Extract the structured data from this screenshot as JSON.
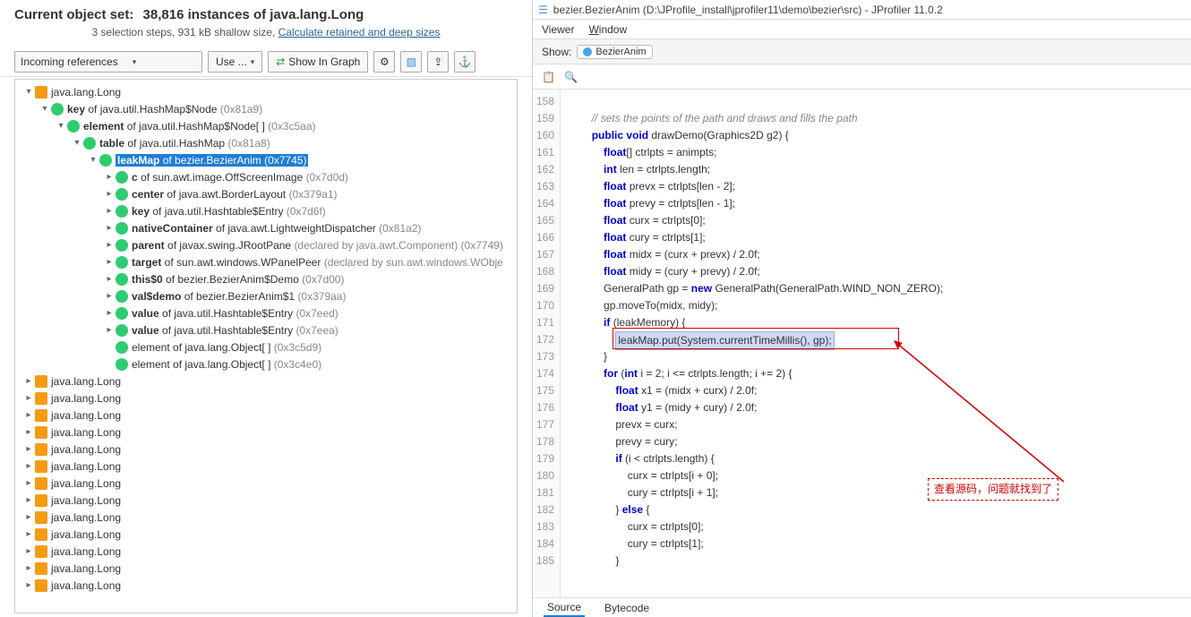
{
  "left": {
    "title_prefix": "Current object set:",
    "title_rest": "38,816 instances of java.lang.Long",
    "subline_prefix": "3 selection steps, 931 kB shallow size,",
    "subline_link": "Calculate retained and deep sizes",
    "view_mode": "Incoming references",
    "use_btn": "Use ...",
    "show_graph": "Show In Graph",
    "tree": [
      {
        "depth": 0,
        "exp": "open",
        "icon": "class",
        "text": "java.lang.Long",
        "addr": ""
      },
      {
        "depth": 1,
        "exp": "open",
        "icon": "field",
        "bold": "key",
        "of": "java.util.HashMap$Node",
        "addr": "(0x81a9)"
      },
      {
        "depth": 2,
        "exp": "open",
        "icon": "field",
        "bold": "element",
        "of": "java.util.HashMap$Node[ ]",
        "addr": "(0x3c5aa)"
      },
      {
        "depth": 3,
        "exp": "open",
        "icon": "field",
        "bold": "table",
        "of": "java.util.HashMap",
        "addr": "(0x81a8)"
      },
      {
        "depth": 4,
        "exp": "open",
        "icon": "field",
        "bold": "leakMap",
        "of": "bezier.BezierAnim",
        "addr": "(0x7745)",
        "selected": true
      },
      {
        "depth": 5,
        "exp": "closed",
        "icon": "field",
        "bold": "c",
        "of": "sun.awt.image.OffScreenImage",
        "addr": "(0x7d0d)"
      },
      {
        "depth": 5,
        "exp": "closed",
        "icon": "field",
        "bold": "center",
        "of": "java.awt.BorderLayout",
        "addr": "(0x379a1)"
      },
      {
        "depth": 5,
        "exp": "closed",
        "icon": "field",
        "bold": "key",
        "of": "java.util.Hashtable$Entry",
        "addr": "(0x7d6f)"
      },
      {
        "depth": 5,
        "exp": "closed",
        "icon": "field",
        "bold": "nativeContainer",
        "of": "java.awt.LightweightDispatcher",
        "addr": "(0x81a2)"
      },
      {
        "depth": 5,
        "exp": "closed",
        "icon": "field",
        "bold": "parent",
        "of": "javax.swing.JRootPane",
        "decl": "(declared by java.awt.Component)",
        "addr": "(0x7749)"
      },
      {
        "depth": 5,
        "exp": "closed",
        "icon": "field",
        "bold": "target",
        "of": "sun.awt.windows.WPanelPeer",
        "decl": "(declared by sun.awt.windows.WObje"
      },
      {
        "depth": 5,
        "exp": "closed",
        "icon": "field",
        "bold": "this$0",
        "of": "bezier.BezierAnim$Demo",
        "addr": "(0x7d00)"
      },
      {
        "depth": 5,
        "exp": "closed",
        "icon": "field",
        "bold": "val$demo",
        "of": "bezier.BezierAnim$1",
        "addr": "(0x379aa)"
      },
      {
        "depth": 5,
        "exp": "closed",
        "icon": "field",
        "bold": "value",
        "of": "java.util.Hashtable$Entry",
        "addr": "(0x7eed)"
      },
      {
        "depth": 5,
        "exp": "closed",
        "icon": "field",
        "bold": "value",
        "of": "java.util.Hashtable$Entry",
        "addr": "(0x7eea)"
      },
      {
        "depth": 5,
        "exp": "none",
        "icon": "field",
        "text": "element of java.lang.Object[ ]",
        "addr": "(0x3c5d9)"
      },
      {
        "depth": 5,
        "exp": "none",
        "icon": "field",
        "text": "element of java.lang.Object[ ]",
        "addr": "(0x3c4e0)"
      },
      {
        "depth": 0,
        "exp": "closed",
        "icon": "class",
        "text": "java.lang.Long"
      },
      {
        "depth": 0,
        "exp": "closed",
        "icon": "class",
        "text": "java.lang.Long"
      },
      {
        "depth": 0,
        "exp": "closed",
        "icon": "class",
        "text": "java.lang.Long"
      },
      {
        "depth": 0,
        "exp": "closed",
        "icon": "class",
        "text": "java.lang.Long"
      },
      {
        "depth": 0,
        "exp": "closed",
        "icon": "class",
        "text": "java.lang.Long"
      },
      {
        "depth": 0,
        "exp": "closed",
        "icon": "class",
        "text": "java.lang.Long"
      },
      {
        "depth": 0,
        "exp": "closed",
        "icon": "class",
        "text": "java.lang.Long"
      },
      {
        "depth": 0,
        "exp": "closed",
        "icon": "class",
        "text": "java.lang.Long"
      },
      {
        "depth": 0,
        "exp": "closed",
        "icon": "class",
        "text": "java.lang.Long"
      },
      {
        "depth": 0,
        "exp": "closed",
        "icon": "class",
        "text": "java.lang.Long"
      },
      {
        "depth": 0,
        "exp": "closed",
        "icon": "class",
        "text": "java.lang.Long"
      },
      {
        "depth": 0,
        "exp": "closed",
        "icon": "class",
        "text": "java.lang.Long"
      },
      {
        "depth": 0,
        "exp": "closed",
        "icon": "class",
        "text": "java.lang.Long"
      }
    ]
  },
  "right": {
    "title": "bezier.BezierAnim (D:\\JProfile_install\\jprofiler11\\demo\\bezier\\src) - JProfiler 11.0.2",
    "menu": {
      "viewer": "Viewer",
      "window": "Window"
    },
    "show_label": "Show:",
    "crumb": "BezierAnim",
    "lines": [
      {
        "n": 158,
        "code": ""
      },
      {
        "n": 159,
        "code": "        // sets the points of the path and draws and fills the path",
        "comm": true
      },
      {
        "n": 160,
        "code": "        public void drawDemo(Graphics2D g2) {",
        "kw": [
          "public",
          "void"
        ]
      },
      {
        "n": 161,
        "code": "            float[] ctrlpts = animpts;",
        "kw": [
          "float"
        ]
      },
      {
        "n": 162,
        "code": "            int len = ctrlpts.length;",
        "kw": [
          "int"
        ]
      },
      {
        "n": 163,
        "code": "            float prevx = ctrlpts[len - 2];",
        "kw": [
          "float"
        ]
      },
      {
        "n": 164,
        "code": "            float prevy = ctrlpts[len - 1];",
        "kw": [
          "float"
        ]
      },
      {
        "n": 165,
        "code": "            float curx = ctrlpts[0];",
        "kw": [
          "float"
        ]
      },
      {
        "n": 166,
        "code": "            float cury = ctrlpts[1];",
        "kw": [
          "float"
        ]
      },
      {
        "n": 167,
        "code": "            float midx = (curx + prevx) / 2.0f;",
        "kw": [
          "float"
        ]
      },
      {
        "n": 168,
        "code": "            float midy = (cury + prevy) / 2.0f;",
        "kw": [
          "float"
        ]
      },
      {
        "n": 169,
        "code": "            GeneralPath gp = new GeneralPath(GeneralPath.WIND_NON_ZERO);",
        "kw": [
          "new"
        ]
      },
      {
        "n": 170,
        "code": "            gp.moveTo(midx, midy);"
      },
      {
        "n": 171,
        "code": "            if (leakMemory) {",
        "kw": [
          "if"
        ]
      },
      {
        "n": 172,
        "code": "                leakMap.put(System.currentTimeMillis(), gp);",
        "hl": true
      },
      {
        "n": 173,
        "code": "            }"
      },
      {
        "n": 174,
        "code": "            for (int i = 2; i <= ctrlpts.length; i += 2) {",
        "kw": [
          "for",
          "int"
        ]
      },
      {
        "n": 175,
        "code": "                float x1 = (midx + curx) / 2.0f;",
        "kw": [
          "float"
        ]
      },
      {
        "n": 176,
        "code": "                float y1 = (midy + cury) / 2.0f;",
        "kw": [
          "float"
        ]
      },
      {
        "n": 177,
        "code": "                prevx = curx;"
      },
      {
        "n": 178,
        "code": "                prevy = cury;"
      },
      {
        "n": 179,
        "code": "                if (i < ctrlpts.length) {",
        "kw": [
          "if"
        ]
      },
      {
        "n": 180,
        "code": "                    curx = ctrlpts[i + 0];"
      },
      {
        "n": 181,
        "code": "                    cury = ctrlpts[i + 1];"
      },
      {
        "n": 182,
        "code": "                } else {",
        "kw": [
          "else"
        ]
      },
      {
        "n": 183,
        "code": "                    curx = ctrlpts[0];"
      },
      {
        "n": 184,
        "code": "                    cury = ctrlpts[1];"
      },
      {
        "n": 185,
        "code": "                }"
      }
    ],
    "annotation": "查看源码，问题就找到了",
    "tabs": {
      "source": "Source",
      "bytecode": "Bytecode"
    }
  }
}
